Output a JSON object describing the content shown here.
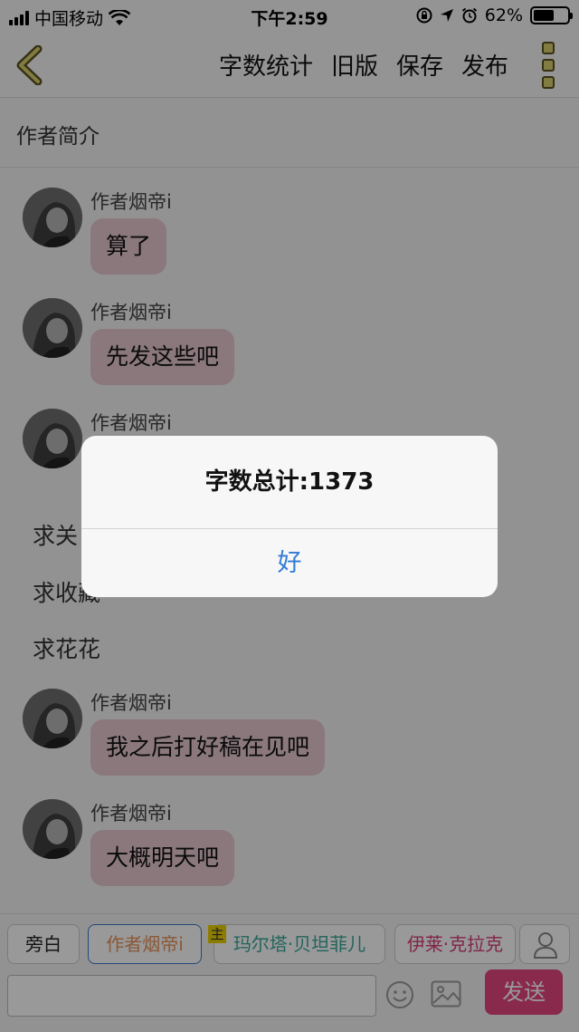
{
  "status_bar": {
    "carrier": "中国移动",
    "time": "下午2:59",
    "battery_percent": "62%",
    "battery_level": 0.62
  },
  "nav": {
    "actions": [
      "字数统计",
      "旧版",
      "保存",
      "发布"
    ],
    "icons": {
      "back": "back-chevron-icon",
      "more": "more-dots-icon"
    },
    "accent": "#d8cf6e"
  },
  "section_title": "作者简介",
  "messages": [
    {
      "name": "作者烟帝i",
      "text": "算了"
    },
    {
      "name": "作者烟帝i",
      "text": "先发这些吧"
    },
    {
      "name": "作者烟帝i",
      "text": ""
    }
  ],
  "plain_lines": [
    "求关",
    "求收藏",
    "求花花"
  ],
  "messages_after": [
    {
      "name": "作者烟帝i",
      "text": "我之后打好稿在见吧"
    },
    {
      "name": "作者烟帝i",
      "text": "大概明天吧"
    }
  ],
  "roles": {
    "narration": "旁白",
    "author": "作者烟帝i",
    "host_badge": "主",
    "character1": "玛尔塔·贝坦菲儿",
    "character2": "伊莱·克拉克"
  },
  "colors": {
    "author_role": "#e8935a",
    "character1": "#3aa79a",
    "character2": "#d83c79",
    "send_button": "#e5457f",
    "bubble": "#e7c9d0",
    "alert_button": "#2f7bd6"
  },
  "input": {
    "placeholder": "",
    "send_label": "发送"
  },
  "alert": {
    "title": "字数总计:1373",
    "button": "好"
  }
}
